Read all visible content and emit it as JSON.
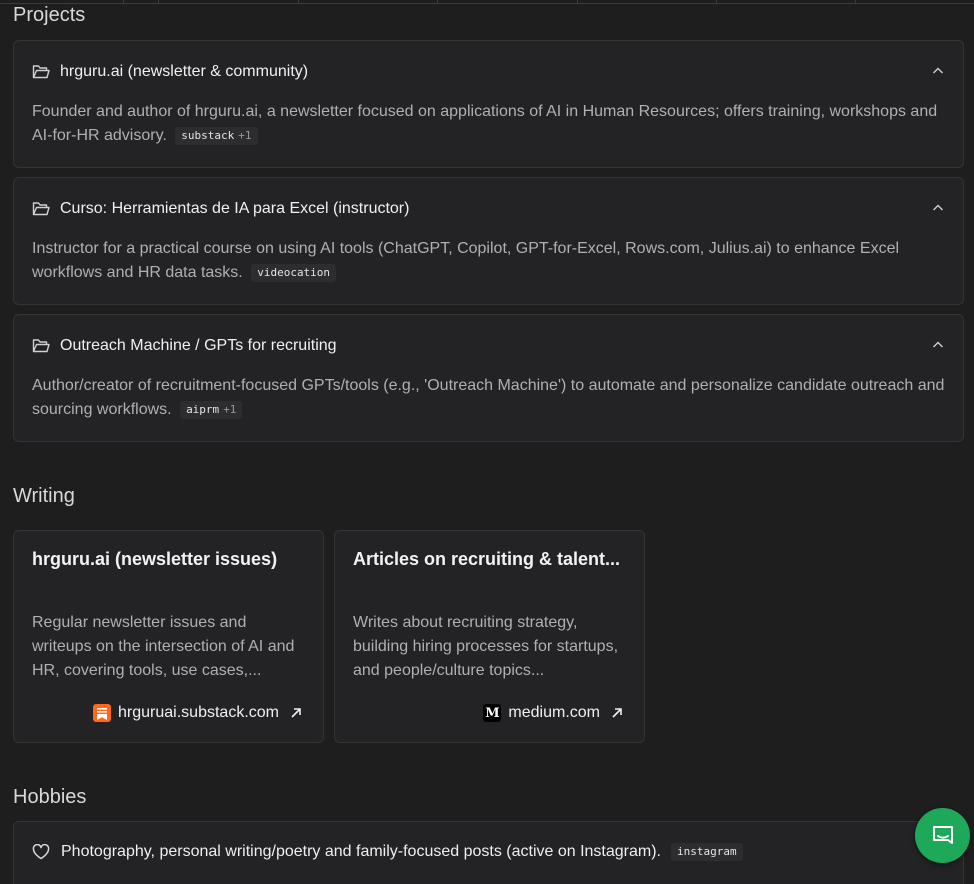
{
  "sections": {
    "projects": "Projects",
    "writing": "Writing",
    "hobbies": "Hobbies"
  },
  "projects": [
    {
      "title": "hrguru.ai (newsletter & community)",
      "description": "Founder and author of hrguru.ai, a newsletter focused on applications of AI in Human Resources; offers training, workshops and AI-for-HR advisory.",
      "tag": "substack",
      "tag_extra": "+1"
    },
    {
      "title": "Curso: Herramientas de IA para Excel (instructor)",
      "description": "Instructor for a practical course on using AI tools (ChatGPT, Copilot, GPT-for-Excel, Rows.com, Julius.ai) to enhance Excel workflows and HR data tasks.",
      "tag": "videocation",
      "tag_extra": ""
    },
    {
      "title": "Outreach Machine / GPTs for recruiting",
      "description": "Author/creator of recruitment-focused GPTs/tools (e.g., 'Outreach Machine') to automate and personalize candidate outreach and sourcing workflows.",
      "tag": "aiprm",
      "tag_extra": "+1"
    }
  ],
  "writing": [
    {
      "title": "hrguru.ai (newsletter issues)",
      "description": "Regular newsletter issues and writeups on the intersection of AI and HR, covering tools, use cases,...",
      "link": "hrguruai.substack.com",
      "icon": "substack-icon",
      "icon_color": "#ff6719"
    },
    {
      "title": "Articles on recruiting & talent...",
      "description": "Writes about recruiting strategy, building hiring processes for startups, and people/culture topics...",
      "link": "medium.com",
      "icon": "medium-icon",
      "icon_color": "#000000",
      "icon_text": "M"
    }
  ],
  "hobbies": [
    {
      "text": "Photography, personal writing/poetry and family-focused posts (active on Instagram).",
      "tag": "instagram"
    }
  ],
  "colors": {
    "background": "#1e1e1f",
    "card": "#232325",
    "chat_button": "#1ea85a"
  }
}
